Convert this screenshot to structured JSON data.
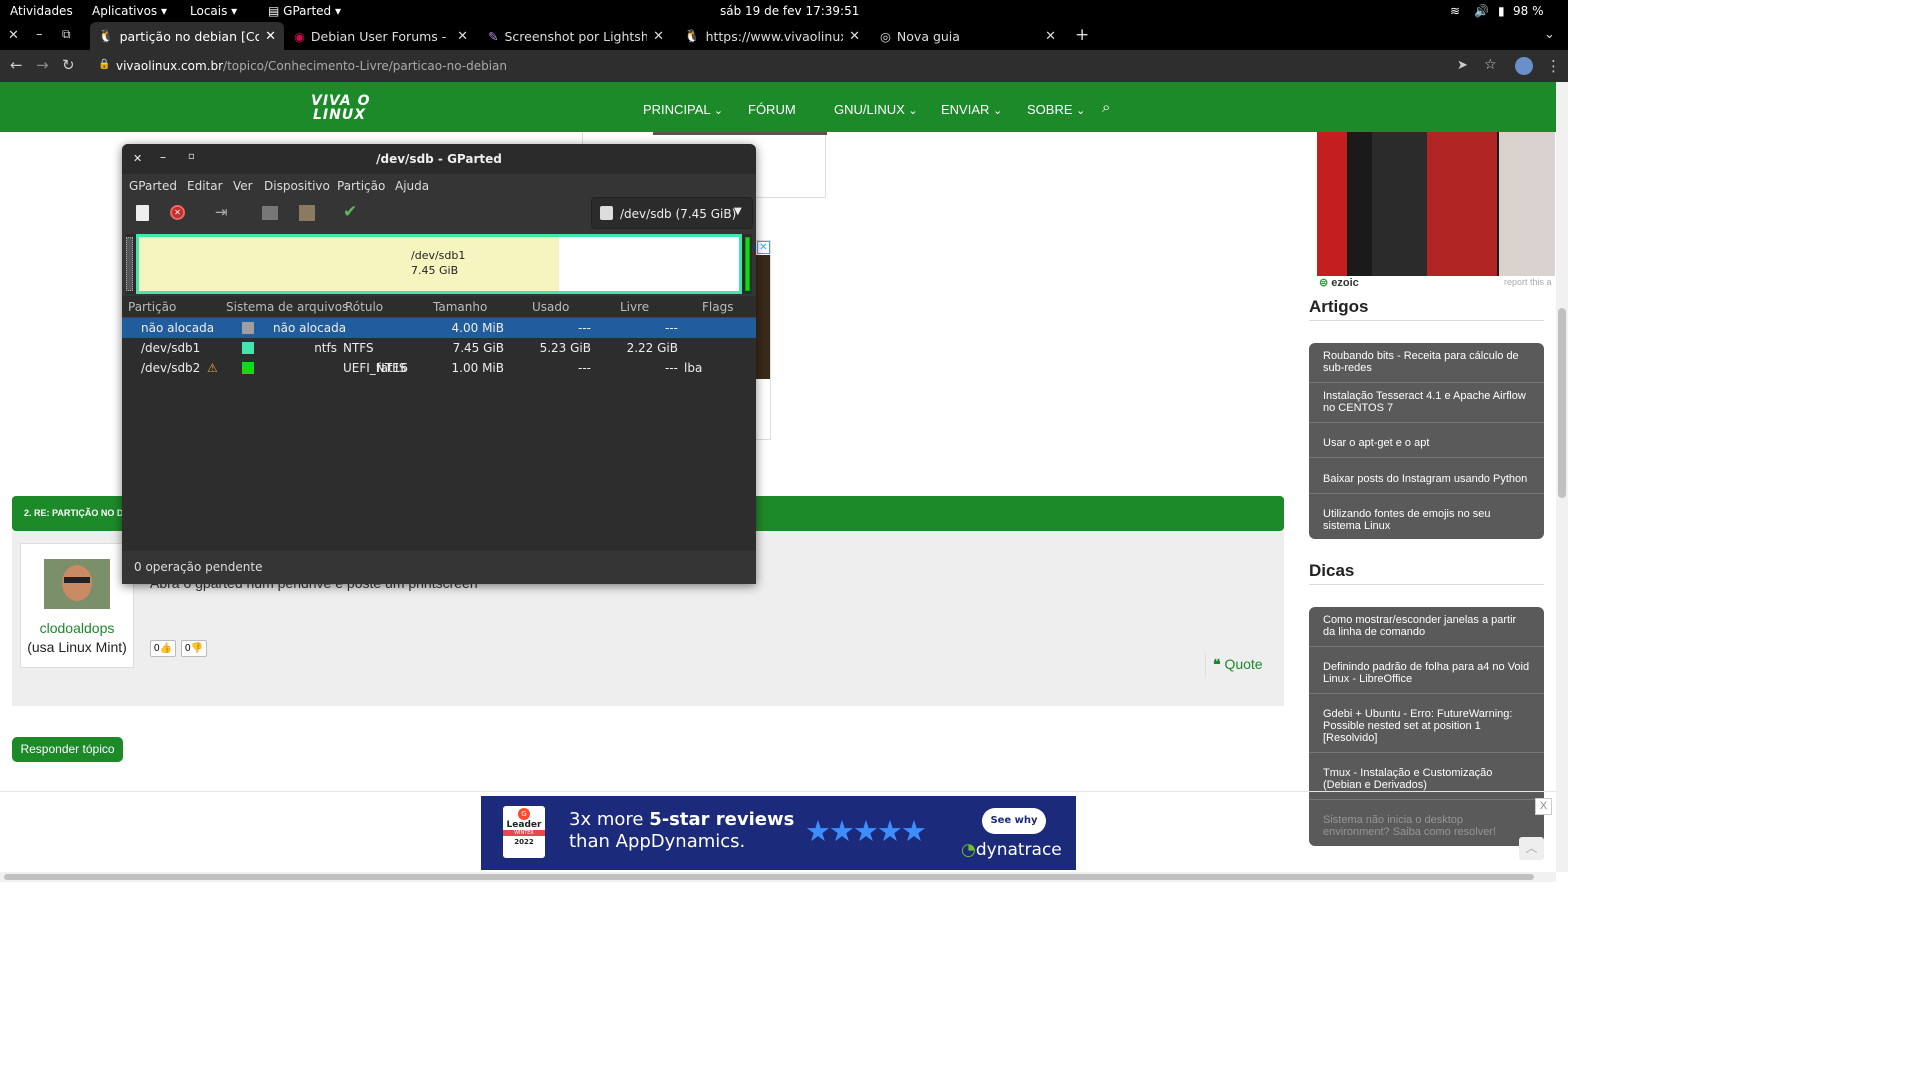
{
  "topbar": {
    "activities": "Atividades",
    "apps": "Aplicativos",
    "places": "Locais",
    "app_name": "GParted",
    "clock": "sáb 19 de fev  17:39:51",
    "battery": "98 %"
  },
  "browser": {
    "tabs": [
      {
        "label": "partição no debian [Conhe",
        "active": true
      },
      {
        "label": "Debian User Forums - Ind",
        "active": false
      },
      {
        "label": "Screenshot por Lightshot",
        "active": false
      },
      {
        "label": "https://www.vivaolinux.co",
        "active": false
      },
      {
        "label": "Nova guia",
        "active": false
      }
    ],
    "url_host": "vivaolinux.com.br",
    "url_path": "/topico/Conhecimento-Livre/particao-no-debian"
  },
  "site": {
    "logo_line1": "VIVA O",
    "logo_line2": "LINUX",
    "nav": [
      "PRINCIPAL",
      "FÓRUM",
      "GNU/LINUX",
      "ENVIAR",
      "SOBRE"
    ],
    "ezoic": "ezoic",
    "report": "report this a",
    "reply_header": "2. RE: PARTIÇÃO NO D",
    "user_name": "clodoaldops",
    "user_distro": "(usa Linux Mint)",
    "post_text": "Abra o gparted num pendrive e poste um printscreen",
    "likes": "0",
    "dislikes": "0",
    "quote": "Quote",
    "reply_button": "Responder tópico"
  },
  "sidebar": {
    "artigos_title": "Artigos",
    "artigos": [
      "Roubando bits - Receita para cálculo de sub-redes",
      "Instalação Tesseract 4.1 e Apache Airflow no CENTOS 7",
      "Usar o apt-get e o apt",
      "Baixar posts do Instagram usando Python",
      "Utilizando fontes de emojis no seu sistema Linux"
    ],
    "dicas_title": "Dicas",
    "dicas": [
      "Como mostrar/esconder janelas a partir da linha de comando",
      "Definindo padrão de folha para a4 no Void Linux - LibreOffice",
      "Gdebi + Ubuntu - Erro: FutureWarning: Possible nested set at position 1 [Resolvido]",
      "Tmux - Instalação e Customização (Debian e Derivados)",
      "Sistema não inicia o desktop environment? Saiba como resolver!"
    ]
  },
  "ad": {
    "badge_top": "Leader",
    "badge_mid": "WINTER",
    "badge_year": "2022",
    "line1_pre": "3x more ",
    "line1_bold": "5-star reviews",
    "line2": "than AppDynamics.",
    "cta": "See why",
    "brand": "dynatrace",
    "close": "X"
  },
  "gparted": {
    "title": "/dev/sdb - GParted",
    "menu": [
      "GParted",
      "Editar",
      "Ver",
      "Dispositivo",
      "Partição",
      "Ajuda"
    ],
    "device": "/dev/sdb (7.45 GiB)",
    "graph_name": "/dev/sdb1",
    "graph_size": "7.45 GiB",
    "graph_used_fraction": 0.7,
    "columns": [
      "Partição",
      "Sistema de arquivos",
      "Rótulo",
      "Tamanho",
      "Usado",
      "Livre",
      "Flags"
    ],
    "rows": [
      {
        "partition": "não alocada",
        "fs": "não alocada",
        "label": "",
        "size": "4.00 MiB",
        "used": "---",
        "free": "---",
        "flags": "",
        "color": "#a0a0a0",
        "warn": false
      },
      {
        "partition": "/dev/sdb1",
        "fs": "ntfs",
        "label": "NTFS",
        "size": "7.45 GiB",
        "used": "5.23 GiB",
        "free": "2.22 GiB",
        "flags": "",
        "color": "#42e5ac",
        "warn": false
      },
      {
        "partition": "/dev/sdb2",
        "fs": "fat16",
        "label": "UEFI_NTFS",
        "size": "1.00 MiB",
        "used": "---",
        "free": "---",
        "flags": "lba",
        "color": "#18d918",
        "warn": true
      }
    ],
    "status": "0 operação pendente"
  }
}
